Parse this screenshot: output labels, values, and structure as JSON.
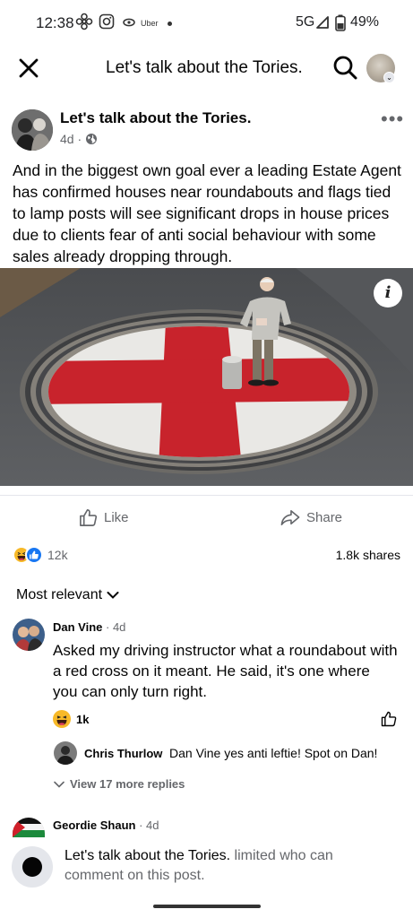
{
  "status_bar": {
    "time": "12:38",
    "uber_label": "Uber",
    "network": "5G",
    "battery": "49%",
    "icons": [
      "fan-icon",
      "instagram-icon",
      "uber-icon",
      "notification-dot-icon",
      "signal-icon",
      "battery-icon"
    ]
  },
  "header": {
    "title": "Let's talk about the Tories.",
    "close_icon": "close-icon",
    "search_icon": "search-icon"
  },
  "post": {
    "page_name": "Let's talk about the Tories.",
    "age": "4d ·",
    "text": "And in the biggest own goal ever a leading Estate Agent has confirmed houses near roundabouts and flags tied to lamp posts will see significant drops in house prices due to clients fear of anti social behaviour with some sales already dropping through.",
    "image_info": "i"
  },
  "actions": {
    "like": "Like",
    "share": "Share"
  },
  "stats": {
    "reactions": "12k",
    "shares": "1.8k shares"
  },
  "comments_sort": "Most relevant",
  "comments": [
    {
      "author": "Dan Vine",
      "age": " · 4d",
      "text": "Asked my driving instructor what a roundabout with a red cross on it meant. He said, it's one where you can only turn right.",
      "reactions": "1k"
    }
  ],
  "reply": {
    "author": "Chris Thurlow",
    "text": "Dan Vine yes anti leftie! Spot on Dan!"
  },
  "view_replies": "View 17 more replies",
  "next_comment": {
    "author": "Geordie Shaun",
    "age": " · 4d"
  },
  "restriction": {
    "page": "Let's talk about the Tories.",
    "text": " limited who can comment on this post."
  },
  "colors": {
    "accent": "#1877f2",
    "secondary_text": "#65676b",
    "flag_red": "#c8232c"
  }
}
